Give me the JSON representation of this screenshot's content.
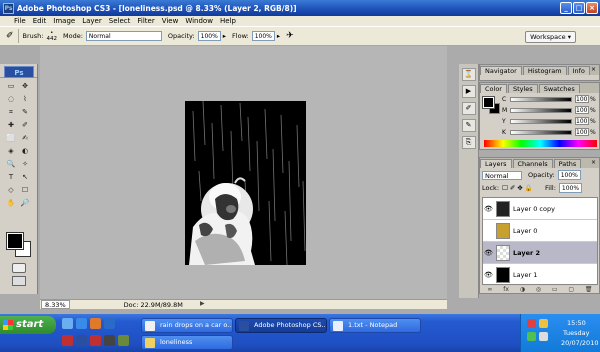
{
  "window": {
    "title": "Adobe Photoshop CS3 - [loneliness.psd @ 8.33% (Layer 2, RGB/8)]",
    "ps_mini": "Ps",
    "minimize": "_",
    "maximize": "□",
    "close": "×"
  },
  "menu": [
    "File",
    "Edit",
    "Image",
    "Layer",
    "Select",
    "Filter",
    "View",
    "Window",
    "Help"
  ],
  "options_bar": {
    "brush_label": "Brush:",
    "brush_size": "442",
    "mode_label": "Mode:",
    "mode_value": "Normal",
    "opacity_label": "Opacity:",
    "opacity_value": "100%",
    "flow_label": "Flow:",
    "flow_value": "100%",
    "workspace_label": "Workspace ▾"
  },
  "toolbox": {
    "logo": "Ps",
    "tools": [
      "▭",
      "✥",
      "◌",
      "⌇",
      "⌗",
      "✎",
      "✚",
      "✐",
      "⬜",
      "✍",
      "◈",
      "◐",
      "🔍",
      "✧",
      "T",
      "↖",
      "◇",
      "☐",
      "✋",
      "🔎"
    ]
  },
  "status": {
    "zoom": "8.33%",
    "doc": "Doc: 22.9M/89.8M",
    "arrow": "▶"
  },
  "panels": {
    "navigator_tabs": [
      "Navigator",
      "Histogram",
      "Info"
    ],
    "color_tabs": [
      "Color",
      "Styles",
      "Swatches"
    ],
    "color_channels": [
      {
        "label": "C",
        "value": "100"
      },
      {
        "label": "M",
        "value": "100"
      },
      {
        "label": "Y",
        "value": "100"
      },
      {
        "label": "K",
        "value": "100"
      }
    ],
    "percent": "%",
    "layers_tabs": [
      "Layers",
      "Channels",
      "Paths"
    ],
    "blend_mode": "Normal",
    "opacity_label": "Opacity:",
    "opacity_value": "100%",
    "lock_label": "Lock:",
    "lock_icons": "☐ ✐ ✥ 🔒",
    "fill_label": "Fill:",
    "fill_value": "100%",
    "layers": [
      {
        "name": "Layer 0 copy",
        "visible": true,
        "thumb": "#222"
      },
      {
        "name": "Layer 0",
        "visible": false,
        "thumb": "#c8a030"
      },
      {
        "name": "Layer 2",
        "visible": true,
        "thumb": "#e0e0e0",
        "selected": true
      },
      {
        "name": "Layer 1",
        "visible": true,
        "thumb": "#000"
      }
    ],
    "eye": "👁",
    "layer_footer": [
      "∞",
      "fx",
      "◑",
      "◎",
      "▭",
      "▢",
      "🗑"
    ],
    "close_x": "×"
  },
  "taskbar": {
    "start": "start",
    "buttons": [
      {
        "label": "rain drops on a car o...",
        "color": "#f0f0f0"
      },
      {
        "label": "Adobe Photoshop CS...",
        "color": "#2a4fa0"
      },
      {
        "label": "1.txt - Notepad",
        "color": "#e8f0ff"
      },
      {
        "label": "loneliness",
        "color": "#f0d060"
      }
    ],
    "time": "15:50",
    "day": "Tuesday",
    "date": "20/07/2010"
  }
}
